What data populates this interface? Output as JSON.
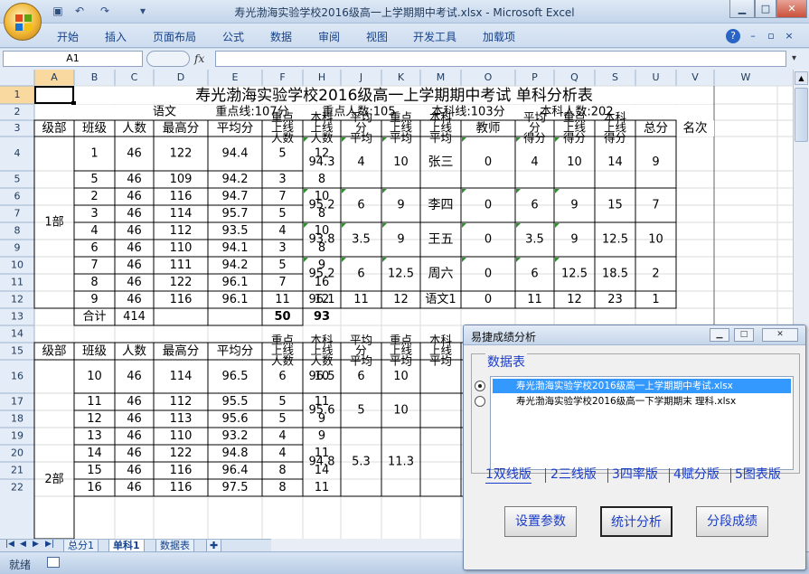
{
  "window": {
    "title": "寿光渤海实验学校2016级高一上学期期中考试.xlsx - Microsoft Excel"
  },
  "ribbon": {
    "tabs": [
      "开始",
      "插入",
      "页面布局",
      "公式",
      "数据",
      "审阅",
      "视图",
      "开发工具",
      "加载项"
    ]
  },
  "formula_bar": {
    "name_box": "A1",
    "fx": "fx",
    "value": ""
  },
  "sheet": {
    "col_headers": [
      "A",
      "B",
      "C",
      "D",
      "E",
      "F",
      "H",
      "J",
      "K",
      "M",
      "O",
      "P",
      "Q",
      "S",
      "U",
      "V",
      "W"
    ],
    "row_numbers": [
      "1",
      "2",
      "3",
      "4",
      "5",
      "6",
      "7",
      "8",
      "9",
      "10",
      "11",
      "12",
      "13",
      "14",
      "15",
      "16",
      "17",
      "18",
      "19",
      "20",
      "21",
      "22"
    ],
    "title": "寿光渤海实验学校2016级高一上学期期中考试 单科分析表",
    "info": {
      "subject": "语文",
      "key_line": "重点线:107分",
      "key_count": "重点人数:105",
      "ben_line": "本科线:103分",
      "ben_count": "本科人数:202"
    },
    "headers": [
      "级部",
      "班级",
      "人数",
      "最高分",
      "平均分",
      "重点上线人数",
      "本科上线人数",
      "平均分平均",
      "重点上线平均",
      "本科上线平均",
      "教师",
      "平均分得分",
      "重点上线得分",
      "本科上线得分",
      "总分",
      "名次"
    ],
    "header_lines": [
      [
        "级部"
      ],
      [
        "班级"
      ],
      [
        "人数"
      ],
      [
        "最高分"
      ],
      [
        "平均分"
      ],
      [
        "重点",
        "上线",
        "人数"
      ],
      [
        "本科",
        "上线",
        "人数"
      ],
      [
        "平均",
        "分",
        "平均"
      ],
      [
        "重点",
        "上线",
        "平均"
      ],
      [
        "本科",
        "上线",
        "平均"
      ],
      [
        "教师"
      ],
      [
        "平均",
        "分",
        "得分"
      ],
      [
        "重点",
        "上线",
        "得分"
      ],
      [
        "本科",
        "上线",
        "得分"
      ],
      [
        "总分"
      ],
      [
        "名次"
      ]
    ],
    "dept1": "1部",
    "dept2": "2部",
    "rows1": [
      [
        "1",
        "46",
        "122",
        "94.4",
        "5",
        "12"
      ],
      [
        "5",
        "46",
        "109",
        "94.2",
        "3",
        "8"
      ],
      [
        "2",
        "46",
        "116",
        "94.7",
        "7",
        "10"
      ],
      [
        "3",
        "46",
        "114",
        "95.7",
        "5",
        "8"
      ],
      [
        "4",
        "46",
        "112",
        "93.5",
        "4",
        "10"
      ],
      [
        "6",
        "46",
        "110",
        "94.1",
        "3",
        "8"
      ],
      [
        "7",
        "46",
        "111",
        "94.2",
        "5",
        "9"
      ],
      [
        "8",
        "46",
        "122",
        "96.1",
        "7",
        "16"
      ],
      [
        "9",
        "46",
        "116",
        "96.1",
        "11",
        "12"
      ]
    ],
    "groups1": [
      {
        "avg": "94.3",
        "key": "4",
        "ben": "10",
        "teacher": "张三",
        "s1": "0",
        "s2": "4",
        "s3": "10",
        "total": "14",
        "rank": "9"
      },
      {
        "avg": "95.2",
        "key": "6",
        "ben": "9",
        "teacher": "李四",
        "s1": "0",
        "s2": "6",
        "s3": "9",
        "total": "15",
        "rank": "7"
      },
      {
        "avg": "93.8",
        "key": "3.5",
        "ben": "9",
        "teacher": "王五",
        "s1": "0",
        "s2": "3.5",
        "s3": "9",
        "total": "12.5",
        "rank": "10"
      },
      {
        "avg": "95.2",
        "key": "6",
        "ben": "12.5",
        "teacher": "周六",
        "s1": "0",
        "s2": "6",
        "s3": "12.5",
        "total": "18.5",
        "rank": "2"
      }
    ],
    "row12_tail": {
      "avg": "96.1",
      "key": "11",
      "ben": "12",
      "teacher": "语文1",
      "s1": "0",
      "s2": "11",
      "s3": "12",
      "total": "23",
      "rank": "1"
    },
    "total_row": {
      "label": "合计",
      "count": "414",
      "key": "50",
      "ben": "93"
    },
    "rows2": [
      [
        "10",
        "46",
        "114",
        "96.5",
        "6",
        "10"
      ],
      [
        "11",
        "46",
        "112",
        "95.5",
        "5",
        "11"
      ],
      [
        "12",
        "46",
        "113",
        "95.6",
        "5",
        "9"
      ],
      [
        "13",
        "46",
        "110",
        "93.2",
        "4",
        "9"
      ],
      [
        "14",
        "46",
        "122",
        "94.8",
        "4",
        "11"
      ],
      [
        "15",
        "46",
        "116",
        "96.4",
        "8",
        "14"
      ],
      [
        "16",
        "46",
        "116",
        "97.5",
        "8",
        "11"
      ]
    ],
    "groups2": [
      {
        "avg": "96.5",
        "key": "6",
        "ben": "10"
      },
      {
        "avg": "95.6",
        "key": "5",
        "ben": "10"
      },
      {
        "avg": "94.8",
        "key": "5.3",
        "ben": "11.3"
      }
    ]
  },
  "sheet_tabs": [
    "总分1",
    "单科1",
    "数据表"
  ],
  "status": {
    "ready": "就绪"
  },
  "dialog": {
    "title": "易捷成绩分析",
    "group_label": "数据表",
    "files": [
      "寿光渤海实验学校2016级高一上学期期中考试.xlsx",
      "寿光渤海实验学校2016级高一下学期期末 理科.xlsx"
    ],
    "tabs": [
      "1双线版",
      "2三线版",
      "3四率版",
      "4赋分版",
      "5图表版"
    ],
    "buttons": [
      "设置参数",
      "统计分析",
      "分段成绩"
    ]
  }
}
